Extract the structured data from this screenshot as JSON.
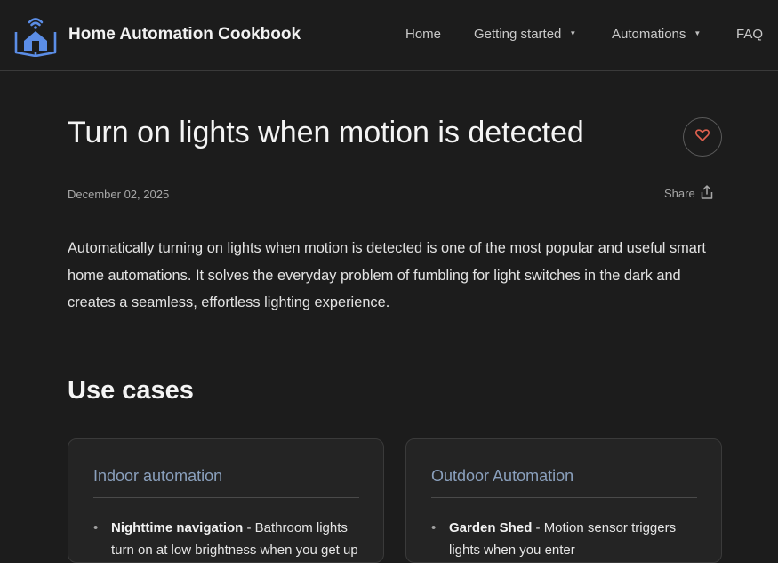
{
  "header": {
    "brand_title": "Home Automation Cookbook",
    "logo_icon": "house-wifi-book-logo",
    "accent_color": "#5b8de6",
    "nav": {
      "home": "Home",
      "getting_started": "Getting started",
      "automations": "Automations",
      "faq": "FAQ"
    }
  },
  "article": {
    "title": "Turn on lights when motion is detected",
    "date": "December 02, 2025",
    "share_label": "Share",
    "intro": "Automatically turning on lights when motion is detected is one of the most popular and useful smart home automations. It solves the everyday problem of fumbling for light switches in the dark and creates a seamless, effortless lighting experience.",
    "favorite_icon": "heart-icon",
    "favorite_color": "#e0614f"
  },
  "use_cases": {
    "title": "Use cases",
    "indoor": {
      "heading": "Indoor automation",
      "item_bold": "Nighttime navigation",
      "item_text": " - Bathroom lights turn on at low brightness when you get up"
    },
    "outdoor": {
      "heading": "Outdoor Automation",
      "item_bold": "Garden Shed",
      "item_text": " - Motion sensor triggers lights when you enter"
    }
  }
}
